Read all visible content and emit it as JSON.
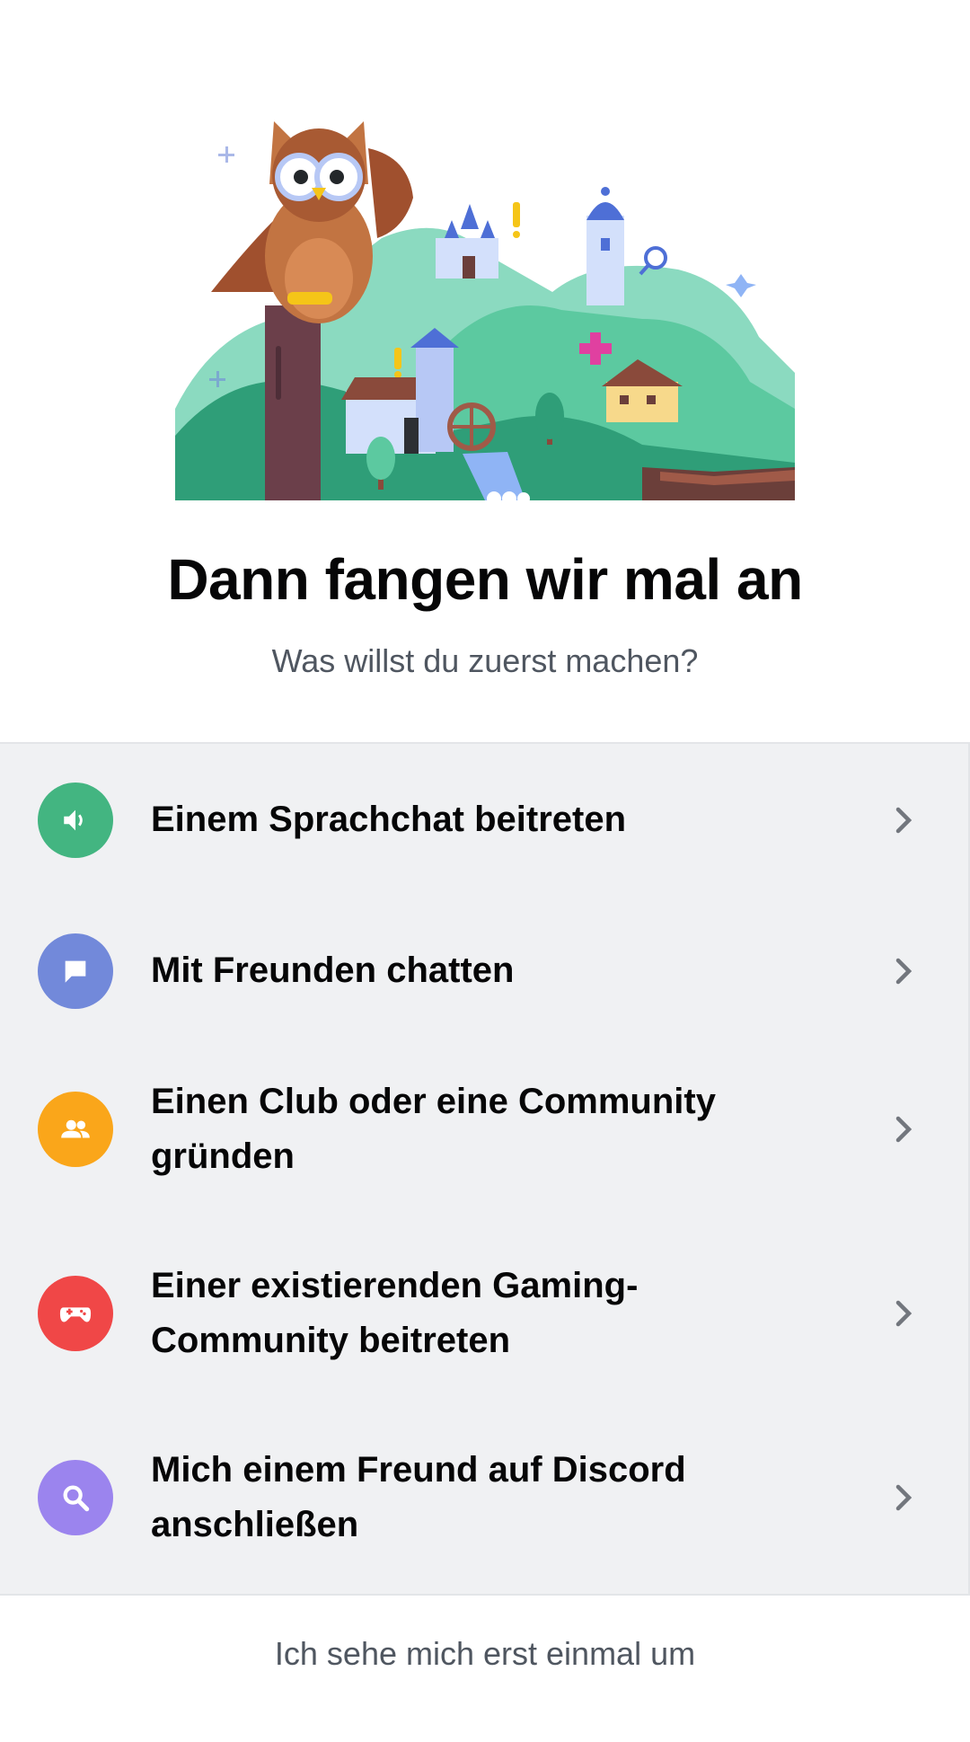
{
  "heading": "Dann fangen wir mal an",
  "subheading": "Was willst du zuerst machen?",
  "options": [
    {
      "label": "Einem Sprachchat beitreten",
      "icon": "speaker-icon",
      "color": "#43b581"
    },
    {
      "label": "Mit Freunden chatten",
      "icon": "chat-bubble-icon",
      "color": "#7289da"
    },
    {
      "label": "Einen Club oder eine Community gründen",
      "icon": "people-icon",
      "color": "#faa61a"
    },
    {
      "label": "Einer existierenden Gaming-Community beitreten",
      "icon": "gamepad-icon",
      "color": "#f04747"
    },
    {
      "label": "Mich einem Freund auf Discord anschließen",
      "icon": "search-icon",
      "color": "#9b84ee"
    }
  ],
  "skip_label": "Ich sehe mich erst einmal um"
}
